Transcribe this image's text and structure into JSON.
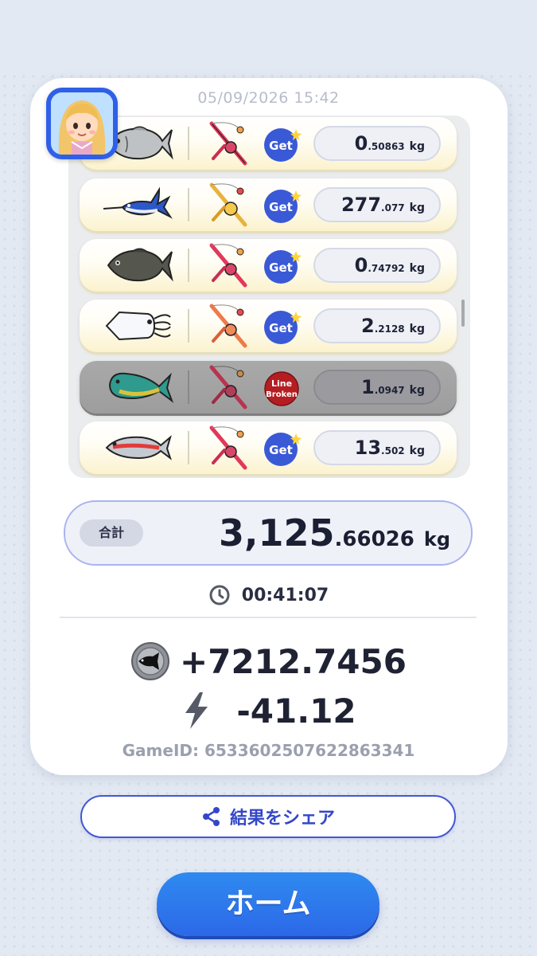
{
  "timestamp": "05/09/2026 15:42",
  "catches": [
    {
      "fish_icon": "grey-porgy-fish-icon",
      "rod_icon": "red-rod-icon",
      "result": "Get",
      "weight_int": "0",
      "weight_dec": ".50863",
      "unit": "kg"
    },
    {
      "fish_icon": "marlin-fish-icon",
      "rod_icon": "gold-rod-icon",
      "result": "Get",
      "weight_int": "277",
      "weight_dec": ".077",
      "unit": "kg"
    },
    {
      "fish_icon": "dark-porgy-fish-icon",
      "rod_icon": "red-rod-icon",
      "result": "Get",
      "weight_int": "0",
      "weight_dec": ".74792",
      "unit": "kg"
    },
    {
      "fish_icon": "squid-icon",
      "rod_icon": "orange-rod-icon",
      "result": "Get",
      "weight_int": "2",
      "weight_dec": ".2128",
      "unit": "kg"
    },
    {
      "fish_icon": "mahi-mahi-fish-icon",
      "rod_icon": "red-rod-icon",
      "result": "Line Broken",
      "weight_int": "1",
      "weight_dec": ".0947",
      "unit": "kg"
    },
    {
      "fish_icon": "neon-fish-icon",
      "rod_icon": "red-rod-icon",
      "result": "Get",
      "weight_int": "13",
      "weight_dec": ".502",
      "unit": "kg"
    }
  ],
  "badges": {
    "get": "Get",
    "line": "Line",
    "broken": "Broken"
  },
  "total": {
    "label": "合計",
    "int": "3,125",
    "dec": ".66026",
    "unit": "kg"
  },
  "elapsed_time": "00:41:07",
  "coins_delta": "+7212.7456",
  "energy_delta": "-41.12",
  "game_id": "GameID: 6533602507622863341",
  "share_label": "結果をシェア",
  "home_label": "ホーム",
  "colors": {
    "accent": "#2f5fe8",
    "get_badge": "#3a59d6",
    "broken_badge": "#b41e22"
  }
}
